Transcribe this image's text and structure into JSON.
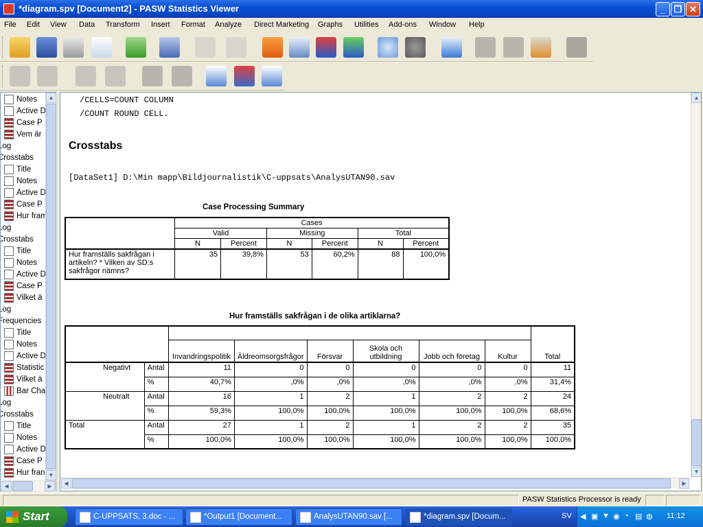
{
  "window": {
    "title": "*diagram.spv [Document2] - PASW Statistics Viewer"
  },
  "menu": [
    "File",
    "Edit",
    "View",
    "Data",
    "Transform",
    "Insert",
    "Format",
    "Analyze",
    "Direct Marketing",
    "Graphs",
    "Utilities",
    "Add-ons",
    "Window",
    "Help"
  ],
  "nav": {
    "items": [
      {
        "icon": "notes-icon",
        "label": "Notes"
      },
      {
        "icon": "active-dataset-icon",
        "label": "Active D"
      },
      {
        "icon": "table-icon",
        "label": "Case P"
      },
      {
        "icon": "table-icon",
        "label": "Vem är"
      },
      {
        "icon": "",
        "label": "Log",
        "top": true
      },
      {
        "icon": "",
        "label": "Crosstabs",
        "top": true
      },
      {
        "icon": "title-icon",
        "label": "Title"
      },
      {
        "icon": "notes-icon",
        "label": "Notes"
      },
      {
        "icon": "active-dataset-icon",
        "label": "Active D"
      },
      {
        "icon": "table-icon",
        "label": "Case P"
      },
      {
        "icon": "table-icon",
        "label": "Hur fram"
      },
      {
        "icon": "",
        "label": "Log",
        "top": true
      },
      {
        "icon": "",
        "label": "Crosstabs",
        "top": true
      },
      {
        "icon": "title-icon",
        "label": "Title"
      },
      {
        "icon": "notes-icon",
        "label": "Notes"
      },
      {
        "icon": "active-dataset-icon",
        "label": "Active D"
      },
      {
        "icon": "table-icon",
        "label": "Case P"
      },
      {
        "icon": "table-icon",
        "label": "Vilket ä"
      },
      {
        "icon": "",
        "label": "Log",
        "top": true
      },
      {
        "icon": "",
        "label": "Frequencies",
        "top": true
      },
      {
        "icon": "title-icon",
        "label": "Title"
      },
      {
        "icon": "notes-icon",
        "label": "Notes"
      },
      {
        "icon": "active-dataset-icon",
        "label": "Active D"
      },
      {
        "icon": "table-icon",
        "label": "Statistic"
      },
      {
        "icon": "table-icon",
        "label": "Vilket ä"
      },
      {
        "icon": "bar-chart-icon",
        "label": "Bar Cha"
      },
      {
        "icon": "",
        "label": "Log",
        "top": true
      },
      {
        "icon": "",
        "label": "Crosstabs",
        "top": true
      },
      {
        "icon": "title-icon",
        "label": "Title"
      },
      {
        "icon": "notes-icon",
        "label": "Notes"
      },
      {
        "icon": "active-dataset-icon",
        "label": "Active D"
      },
      {
        "icon": "table-icon",
        "label": "Case P"
      },
      {
        "icon": "table-icon",
        "label": "Hur fran"
      }
    ]
  },
  "output": {
    "syntax_line1": "/CELLS=COUNT COLUMN",
    "syntax_line2": "/COUNT ROUND CELL.",
    "heading": "Crosstabs",
    "dataset": "[DataSet1] D:\\Min mapp\\Bildjournalistik\\C-uppsats\\AnalysUTAN90.sav",
    "cps": {
      "title": "Case Processing Summary",
      "cases": "Cases",
      "groups": [
        "Valid",
        "Missing",
        "Total"
      ],
      "sub": [
        "N",
        "Percent",
        "N",
        "Percent",
        "N",
        "Percent"
      ],
      "row_label": "Hur framställs sakfrågan i artikeln? * Vilken av SD:s sakfrågor nämns?",
      "values": [
        "35",
        "39,8%",
        "53",
        "60,2%",
        "88",
        "100,0%"
      ]
    },
    "xt": {
      "title": "Hur framställs sakfrågan i de olika artiklarna?",
      "cols": [
        "Invandringspolitik",
        "Äldreomsorgsfrågor",
        "Försvar",
        "Skola och utbildning",
        "Jobb och företag",
        "Kultur",
        "Total"
      ],
      "rows": [
        {
          "group": "Negativt",
          "stat": "Antal",
          "vals": [
            "11",
            "0",
            "0",
            "0",
            "0",
            "0",
            "11"
          ]
        },
        {
          "group": "",
          "stat": "%",
          "vals": [
            "40,7%",
            ",0%",
            ",0%",
            ",0%",
            ",0%",
            ",0%",
            "31,4%"
          ]
        },
        {
          "group": "Neutralt",
          "stat": "Antal",
          "vals": [
            "16",
            "1",
            "2",
            "1",
            "2",
            "2",
            "24"
          ]
        },
        {
          "group": "",
          "stat": "%",
          "vals": [
            "59,3%",
            "100,0%",
            "100,0%",
            "100,0%",
            "100,0%",
            "100,0%",
            "68,6%"
          ]
        },
        {
          "group": "Total",
          "stat": "Antal",
          "vals": [
            "27",
            "1",
            "2",
            "1",
            "2",
            "2",
            "35"
          ]
        },
        {
          "group": "",
          "stat": "%",
          "vals": [
            "100,0%",
            "100,0%",
            "100,0%",
            "100,0%",
            "100,0%",
            "100,0%",
            "100,0%"
          ]
        }
      ]
    }
  },
  "status": {
    "text": "PASW Statistics Processor is ready"
  },
  "taskbar": {
    "start": "Start",
    "tasks": [
      "C-UPPSATS, 3.doc - ...",
      "*Output1 [Document...",
      "AnalysUTAN90.sav [...",
      "*diagram.spv [Docum..."
    ],
    "lang": "SV",
    "clock": "11:12"
  }
}
